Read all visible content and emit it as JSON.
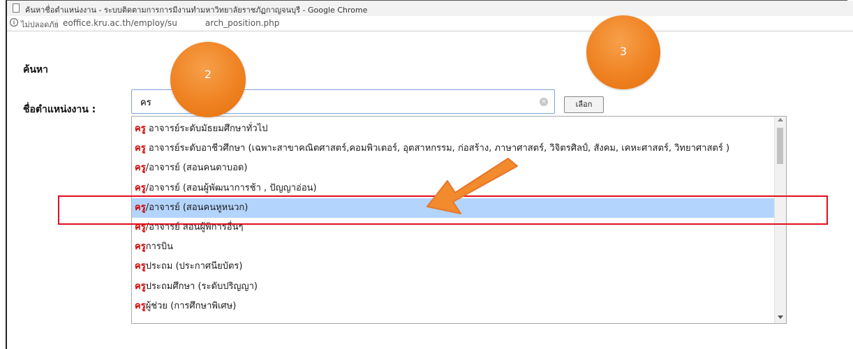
{
  "window": {
    "title": "ค้นหาชื่อตำแหน่งงาน - ระบบติดตามการการมีงานทำมหาวิทยาลัยราชภัฏกาญจนบุรี - Google Chrome"
  },
  "addressbar": {
    "info_icon": "i",
    "security_label": "ไม่ปลอดภัย",
    "url_prefix": "eoffice.kru.ac.th/employ/su",
    "url_suffix": "arch_position.php"
  },
  "page": {
    "heading": "ค้นหา",
    "field_label": "ชื่อตำแหน่งงาน :",
    "search_value": "คร",
    "clear_icon": "×",
    "select_button": "เลือก"
  },
  "dropdown": {
    "items": [
      {
        "match": "ครู",
        "rest": " อาจารย์ระดับมัธยมศึกษาทั่วไป",
        "selected": false
      },
      {
        "match": "ครู",
        "rest": " อาจารย์ระดับอาชีวศึกษา (เฉพาะสาขาคณิตศาสตร์,คอมพิวเตอร์, อุตสาหกรรม, ก่อสร้าง, ภาษาศาสตร์, วิจิตรศิลป์, สังคม, เคหะศาสตร์, วิทยาศาสตร์ )",
        "selected": false
      },
      {
        "match": "ครู",
        "rest": "/อาจารย์ (สอนคนตาบอด)",
        "selected": false
      },
      {
        "match": "ครู",
        "rest": "/อาจารย์ (สอนผู้พัฒนาการช้า , ปัญญาอ่อน)",
        "selected": false
      },
      {
        "match": "ครู",
        "rest": "/อาจารย์ (สอนคนหูหนวก)",
        "selected": true
      },
      {
        "match": "ครู",
        "rest": "/อาจารย์ สอนผู้พิการอื่นๆ",
        "selected": false
      },
      {
        "match": "ครู",
        "rest": "การบิน",
        "selected": false
      },
      {
        "match": "ครู",
        "rest": "ประถม (ประกาศนียบัตร)",
        "selected": false
      },
      {
        "match": "ครู",
        "rest": "ประถมศึกษา (ระดับปริญญา)",
        "selected": false
      },
      {
        "match": "ครู",
        "rest": "ผู้ช่วย (การศึกษาพิเศษ)",
        "selected": false
      }
    ]
  },
  "annotations": {
    "step2": "2",
    "step3": "3",
    "accent_color": "#ef8222",
    "highlight_box_color": "#e10e1c"
  }
}
